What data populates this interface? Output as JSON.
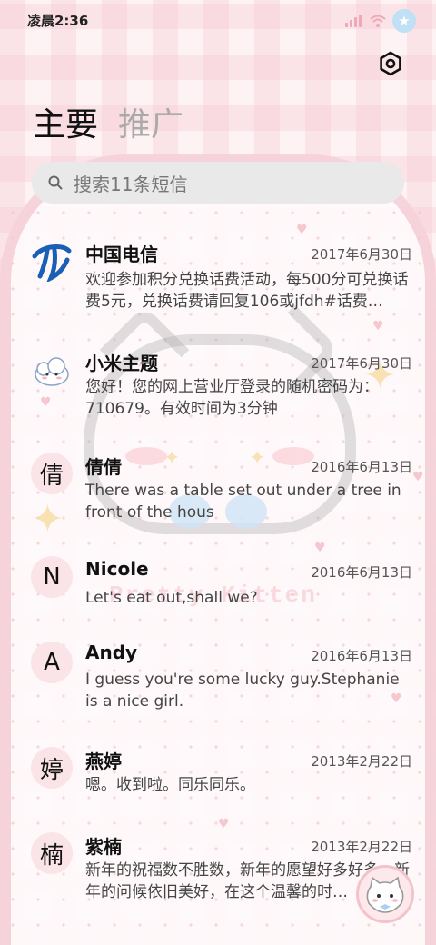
{
  "status_bar": {
    "time": "凌晨2:36"
  },
  "tabs": [
    {
      "label": "主要",
      "active": true
    },
    {
      "label": "推广",
      "active": false
    }
  ],
  "search": {
    "placeholder": "搜索11条短信"
  },
  "background": {
    "watermark": "Pretty Kitten"
  },
  "messages": [
    {
      "sender": "中国电信",
      "date": "2017年6月30日",
      "preview": "欢迎参加积分兑换话费活动，每500分可兑换话费5元，兑换话费请回复106或jfdh#话费…",
      "avatar": "telecom-logo"
    },
    {
      "sender": "小米主题",
      "date": "2017年6月30日",
      "preview": "您好！您的网上营业厅登录的随机密码为：710679。有效时间为3分钟",
      "avatar": "cloud-mascot"
    },
    {
      "sender": "倩倩",
      "date": "2016年6月13日",
      "preview": "There was a table set out under a tree in front of the hous",
      "avatar": "倩"
    },
    {
      "sender": "Nicole",
      "date": "2016年6月13日",
      "preview": "Let's eat out,shall we?",
      "avatar": "N"
    },
    {
      "sender": "Andy",
      "date": "2016年6月13日",
      "preview": "I guess you're some lucky guy.Stephanie is a nice girl.",
      "avatar": "A"
    },
    {
      "sender": "燕婷",
      "date": "2013年2月22日",
      "preview": "嗯。收到啦。同乐同乐。",
      "avatar": "婷"
    },
    {
      "sender": "紫楠",
      "date": "2013年2月22日",
      "preview": "新年的祝福数不胜数，新年的愿望好多好多，新年的问候依旧美好，在这个温馨的时…",
      "avatar": "楠"
    }
  ],
  "colors": {
    "accent": "#f6d3da",
    "background": "#fdf2f4",
    "avatar_bg": "#fbe4e8"
  }
}
